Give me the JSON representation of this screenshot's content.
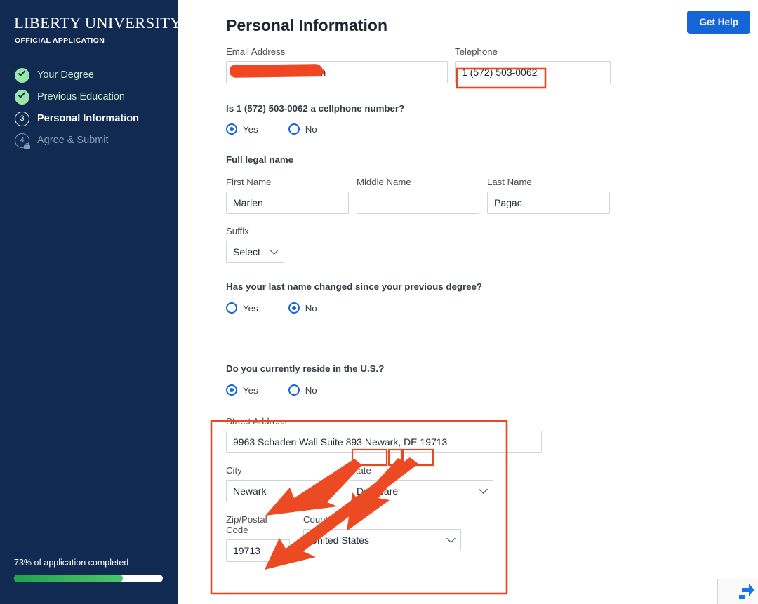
{
  "sidebar": {
    "brand": "LIBERTY UNIVERSITY",
    "brand_sub": "OFFICIAL APPLICATION",
    "items": [
      {
        "label": "Your Degree",
        "state": "done",
        "icon": "check-circle-icon",
        "number": "1"
      },
      {
        "label": "Previous Education",
        "state": "done",
        "icon": "check-circle-icon",
        "number": "2"
      },
      {
        "label": "Personal Information",
        "state": "current",
        "icon": "step-number-icon",
        "number": "3"
      },
      {
        "label": "Agree & Submit",
        "state": "locked",
        "icon": "lock-icon",
        "number": "4"
      }
    ],
    "progress_text": "73% of application completed",
    "progress_percent": 73,
    "bg_color": "#102a52",
    "progress_color": "#31b45d"
  },
  "header": {
    "title": "Personal Information",
    "get_help_label": "Get Help",
    "get_help_color": "#1565d8"
  },
  "form": {
    "email": {
      "label": "Email Address",
      "value": ".com",
      "redacted": true
    },
    "telephone": {
      "label": "Telephone",
      "value": "1 (572) 503-0062"
    },
    "cellphone_question": {
      "label": "Is 1 (572) 503-0062 a cellphone number?",
      "options": [
        "Yes",
        "No"
      ],
      "selected": "Yes"
    },
    "full_legal_name": {
      "section_label": "Full legal name",
      "first_name": {
        "label": "First Name",
        "value": "Marlen"
      },
      "middle_name": {
        "label": "Middle Name",
        "value": ""
      },
      "last_name": {
        "label": "Last Name",
        "value": "Pagac"
      },
      "suffix": {
        "label": "Suffix",
        "value": "Select"
      }
    },
    "name_changed_question": {
      "label": "Has your last name changed since your previous degree?",
      "options": [
        "Yes",
        "No"
      ],
      "selected": "No"
    },
    "reside_us_question": {
      "label": "Do you currently reside in the U.S.?",
      "options": [
        "Yes",
        "No"
      ],
      "selected": "Yes"
    },
    "address": {
      "street": {
        "label": "Street Address",
        "value": "9963 Schaden Wall Suite 893 Newark, DE 19713"
      },
      "street_parts": {
        "base": "9963 Schaden Wall Suite 893",
        "city": "Newark,",
        "state": "DE",
        "zip": "19713"
      },
      "city": {
        "label": "City",
        "value": "Newark"
      },
      "state": {
        "label": "State",
        "value": "Delaware"
      },
      "zip": {
        "label": "Zip/Postal Code",
        "value": "19713"
      },
      "country": {
        "label": "Country",
        "value": "United States"
      }
    }
  },
  "annotations": {
    "color": "#e8481f",
    "boxes": [
      "telephone-value",
      "street-city-token",
      "street-state-token",
      "street-zip-token",
      "address-section"
    ],
    "arrows": [
      "city-token-to-city-field",
      "state-token-to-state-field",
      "zip-token-to-zip-field"
    ]
  }
}
